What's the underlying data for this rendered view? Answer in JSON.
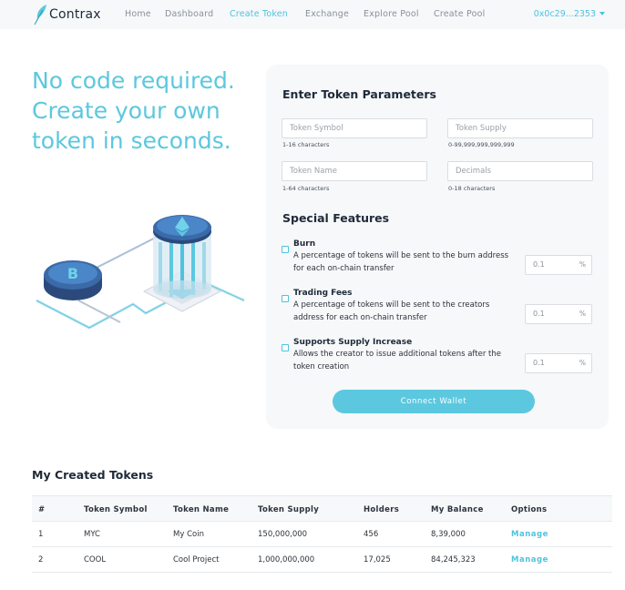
{
  "brand": {
    "name": "Contrax",
    "accent": "#5bc8df"
  },
  "nav": {
    "items": [
      {
        "label": "Home"
      },
      {
        "label": "Dashboard"
      },
      {
        "label": "Create Token"
      },
      {
        "label": "Exchange"
      },
      {
        "label": "Explore Pool"
      },
      {
        "label": "Create Pool"
      }
    ],
    "active": "Create Token",
    "wallet": "0x0c29...2353"
  },
  "hero": {
    "title": "No code required. Create your own token in seconds."
  },
  "form": {
    "heading": "Enter Token Parameters",
    "fields": [
      {
        "placeholder": "Token Symbol",
        "hint": "1-16 characters"
      },
      {
        "placeholder": "Token Supply",
        "hint": "0-99,999,999,999,999"
      },
      {
        "placeholder": "Token Name",
        "hint": "1-64 characters"
      },
      {
        "placeholder": "Decimals",
        "hint": "0-18 characters"
      }
    ],
    "features_heading": "Special Features",
    "features": [
      {
        "title": "Burn",
        "description": "A percentage of tokens will be sent to the burn address for each on-chain transfer",
        "value": "0.1",
        "unit": "%"
      },
      {
        "title": "Trading Fees",
        "description": "A percentage of tokens will be sent to the creators address for each on-chain transfer",
        "value": "0.1",
        "unit": "%"
      },
      {
        "title": "Supports Supply Increase",
        "description": "Allows the creator to issue additional tokens after the token creation",
        "value": "0.1",
        "unit": "%"
      }
    ],
    "submit": "Connect Wallet"
  },
  "tokens": {
    "title": "My Created Tokens",
    "columns": [
      "#",
      "Token Symbol",
      "Token Name",
      "Token Supply",
      "Holders",
      "My Balance",
      "Options"
    ],
    "rows": [
      [
        "1",
        "MYC",
        "My Coin",
        "150,000,000",
        "456",
        "8,39,000",
        "Manage"
      ],
      [
        "2",
        "COOL",
        "Cool Project",
        "1,000,000,000",
        "17,025",
        "84,245,323",
        "Manage"
      ]
    ]
  }
}
